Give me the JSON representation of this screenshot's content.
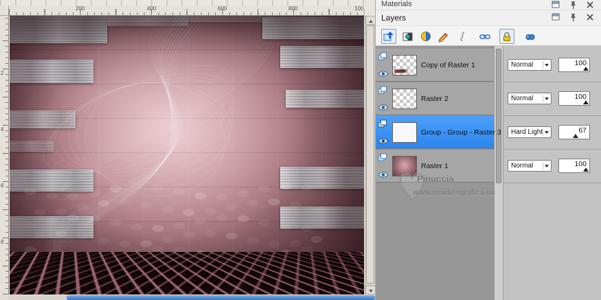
{
  "materials": {
    "title": "Materials"
  },
  "layers_panel": {
    "title": "Layers"
  },
  "rulers": {
    "top": [
      "200",
      "400",
      "600",
      "800",
      "100"
    ],
    "left": [
      "2",
      "4",
      "6",
      "8"
    ]
  },
  "toolbar_icons": [
    "new-layer",
    "new-mask-layer",
    "new-adjustment-layer",
    "edit-selection",
    "script",
    "link-layers",
    "lock-transparency",
    "binoculars"
  ],
  "layers": [
    {
      "name": "Copy of Raster 1",
      "blend": "Normal",
      "opacity": "100"
    },
    {
      "name": "Raster 2",
      "blend": "Normal",
      "opacity": "100"
    },
    {
      "name": "Group - Group - Raster 3",
      "blend": "Hard Light",
      "opacity": "67"
    },
    {
      "name": "Raster 1",
      "blend": "Normal",
      "opacity": "100"
    }
  ],
  "watermark": {
    "name": "Pinuccia",
    "site": "www.maidiregrafica.eu"
  },
  "colors": {
    "selected_row": "#2e8ef5",
    "accent_blue": "#3c78c4"
  }
}
